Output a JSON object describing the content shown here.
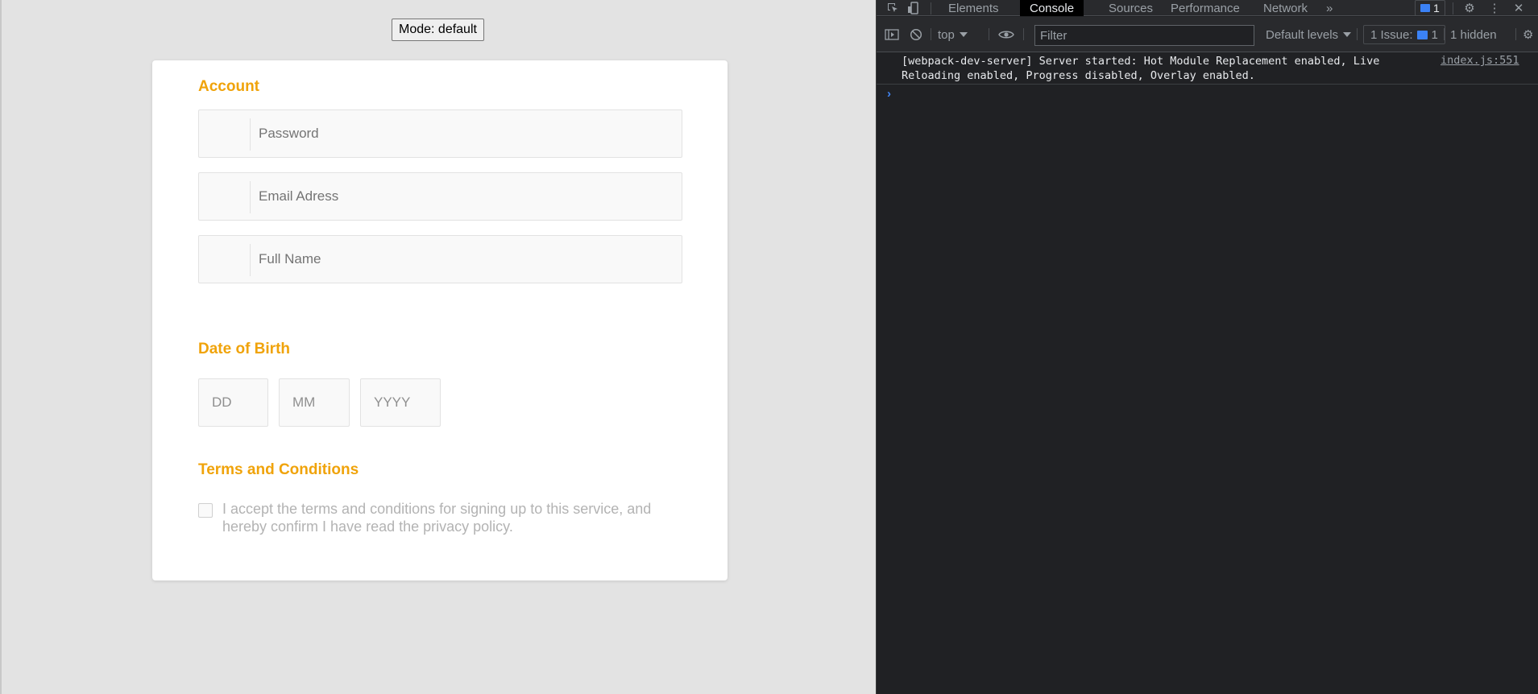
{
  "page": {
    "mode_button": "Mode: default",
    "account": {
      "title": "Account",
      "fields": [
        {
          "placeholder": "Password"
        },
        {
          "placeholder": "Email Adress"
        },
        {
          "placeholder": "Full Name"
        }
      ]
    },
    "dob": {
      "title": "Date of Birth",
      "day": "DD",
      "month": "MM",
      "year": "YYYY"
    },
    "terms": {
      "title": "Terms and Conditions",
      "text": "I accept the terms and conditions for signing up to this service, and hereby confirm I have read the privacy policy.",
      "checked": false
    },
    "accent_color": "#f0a30a"
  },
  "devtools": {
    "tabs": [
      "Elements",
      "Console",
      "Sources",
      "Performance",
      "Network"
    ],
    "active_tab": "Console",
    "more_tabs": "»",
    "message_badge": "1",
    "toolbar": {
      "context": "top",
      "filter_placeholder": "Filter",
      "levels": "Default levels",
      "issues": "1 Issue:",
      "issues_count": "1",
      "hidden": "1 hidden"
    },
    "console": {
      "message": "[webpack-dev-server] Server started: Hot Module Replacement enabled, Live Reloading enabled, Progress disabled, Overlay enabled.",
      "source": "index.js:551",
      "prompt": "›"
    }
  }
}
